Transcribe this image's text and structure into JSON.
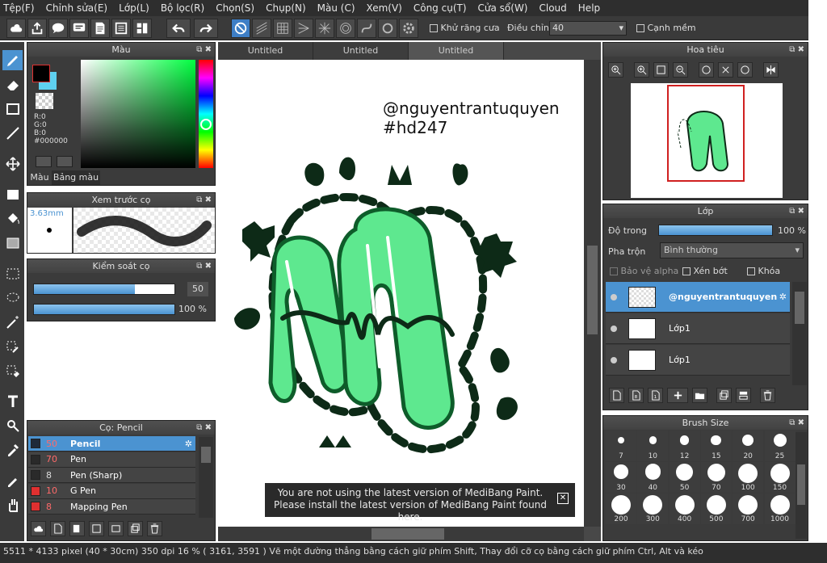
{
  "menu": [
    "Tệp(F)",
    "Chỉnh sửa(E)",
    "Lớp(L)",
    "Bộ lọc(R)",
    "Chọn(S)",
    "Chụp(N)",
    "Màu (C)",
    "Xem(V)",
    "Công cụ(T)",
    "Cửa sổ(W)",
    "Cloud",
    "Help"
  ],
  "toolbar": {
    "antialias_label": "Khử răng cưa",
    "adjust_label": "Điều chỉnh",
    "adjust_value": "40",
    "soft_edge_label": "Cạnh mềm"
  },
  "color_panel": {
    "title": "Màu",
    "r": "R:0",
    "g": "G:0",
    "b": "B:0",
    "hex": "#000000",
    "tab_color": "Màu",
    "tab_palette": "Bảng màu"
  },
  "brush_preview": {
    "title": "Xem trước cọ",
    "size": "3.63mm"
  },
  "brush_control": {
    "title": "Kiểm soát cọ",
    "size_value": "50",
    "opacity_value": "100 %",
    "size_fraction": 0.72,
    "opacity_fraction": 1.0
  },
  "brush_list": {
    "title": "Cọ: Pencil",
    "items": [
      {
        "size": "50",
        "name": "Pencil",
        "color": "#1e2a3a",
        "selected": true
      },
      {
        "size": "70",
        "name": "Pen",
        "color": "#2a2a2a",
        "selected": false
      },
      {
        "size": "8",
        "name": "Pen (Sharp)",
        "color": "#2a2a2a",
        "selected": false
      },
      {
        "size": "10",
        "name": "G Pen",
        "color": "#e03030",
        "selected": false
      },
      {
        "size": "8",
        "name": "Mapping Pen",
        "color": "#e03030",
        "selected": false
      }
    ]
  },
  "canvas": {
    "tabs": [
      "Untitled",
      "Untitled",
      "Untitled"
    ],
    "watermark_line1": "@nguyentrantuquyen",
    "watermark_line2": "#hd247",
    "notice_line1": "You are not using the latest version of MediBang Paint.",
    "notice_line2": "Please install the latest version of MediBang Paint found here."
  },
  "navigator": {
    "title": "Hoa tiêu"
  },
  "layer_panel": {
    "title": "Lớp",
    "opacity_label": "Độ trong",
    "opacity_value": "100 %",
    "opacity_fraction": 1.0,
    "blend_label": "Pha trộn",
    "blend_value": "Bình thường",
    "protect_alpha": "Bảo vệ alpha",
    "clipping": "Xén bớt",
    "lock": "Khóa",
    "layers": [
      {
        "name": "@nguyentrantuquyen",
        "selected": true
      },
      {
        "name": "Lớp1",
        "selected": false
      },
      {
        "name": "Lớp1",
        "selected": false
      }
    ]
  },
  "brush_size_panel": {
    "title": "Brush Size",
    "sizes": [
      "7",
      "10",
      "12",
      "15",
      "20",
      "25",
      "30",
      "40",
      "50",
      "70",
      "100",
      "150",
      "200",
      "300",
      "400",
      "500",
      "700",
      "1000"
    ]
  },
  "status": "5511 * 4133 pixel  (40 * 30cm)  350 dpi  16 %  ( 3161, 3591 )  Vẽ một đường thẳng bằng cách giữ phím Shift, Thay đổi cỡ cọ bằng cách giữ phím Ctrl, Alt và kéo",
  "colors": {
    "accent": "#4b93d1",
    "green_light": "#5ee88f",
    "green_dark": "#0e5c2a",
    "dark": "#0d2a17"
  }
}
